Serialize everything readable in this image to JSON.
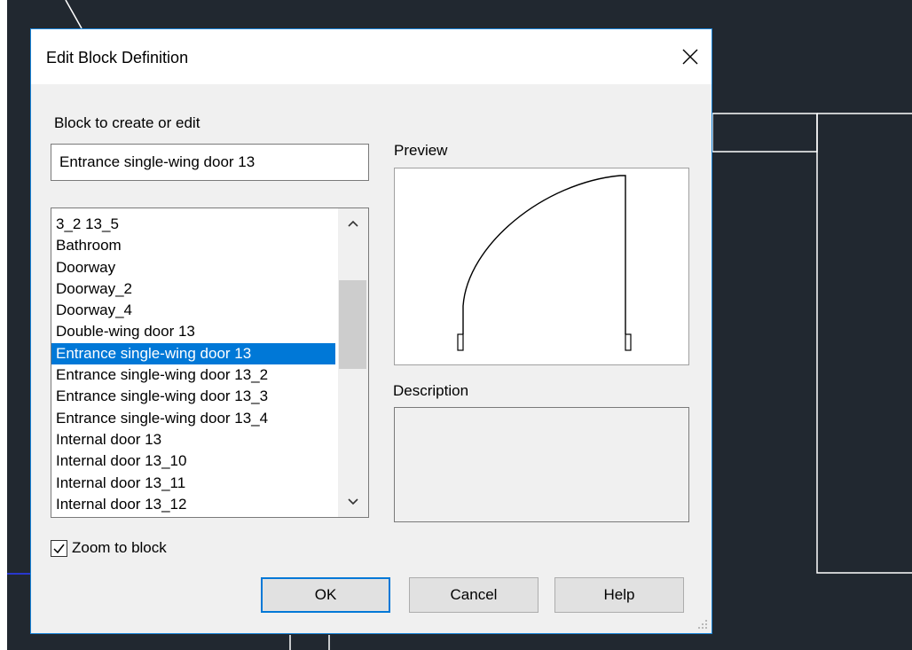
{
  "dialog": {
    "title": "Edit Block Definition",
    "block_label": "Block to create or edit",
    "block_name_value": "Entrance single-wing door 13",
    "preview_label": "Preview",
    "description_label": "Description",
    "zoom_checkbox_label": "Zoom to block",
    "zoom_checked": true
  },
  "block_list": {
    "items": [
      "3_2 13_5",
      "Bathroom",
      "Doorway",
      "Doorway_2",
      "Doorway_4",
      "Double-wing door 13",
      "Entrance single-wing door 13",
      "Entrance single-wing door 13_2",
      "Entrance single-wing door 13_3",
      "Entrance single-wing door 13_4",
      "Internal door 13",
      "Internal door 13_10",
      "Internal door 13_11",
      "Internal door 13_12"
    ],
    "selected_index": 6
  },
  "buttons": {
    "ok": "OK",
    "cancel": "Cancel",
    "help": "Help"
  },
  "colors": {
    "cad_background": "#212830",
    "cad_lines": "#ffffff",
    "selection": "#0078d7",
    "dialog_border": "#1883d7"
  }
}
